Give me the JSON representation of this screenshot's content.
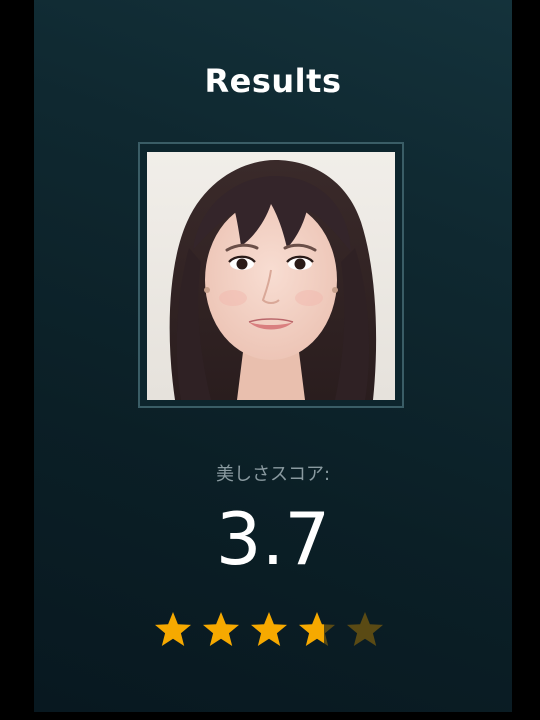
{
  "header": {
    "title": "Results"
  },
  "photo": {
    "icon": "face-photo"
  },
  "score": {
    "label": "美しさスコア:",
    "value": "3.7",
    "rating": 3.7,
    "max": 5
  },
  "colors": {
    "background": "#0f2830",
    "frame": "#3a5d66",
    "star_filled": "#f6a900",
    "star_empty": "#5a4a14",
    "label": "#8a9aa0"
  }
}
